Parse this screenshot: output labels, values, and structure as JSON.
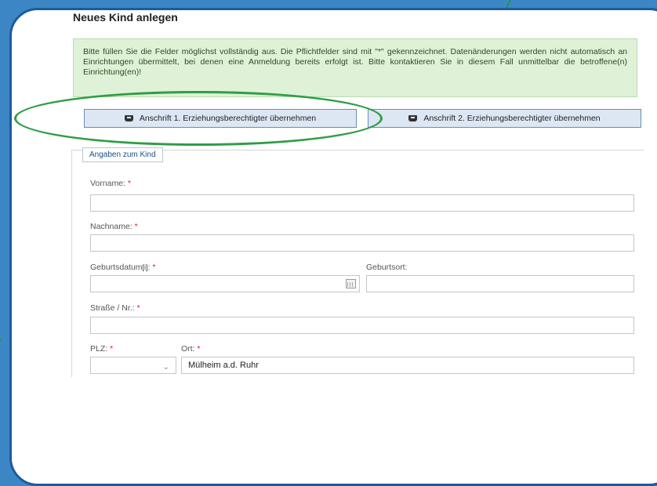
{
  "page": {
    "title": "Neues Kind anlegen",
    "notice": "Bitte füllen Sie die Felder möglichst vollständig aus. Die Pflichtfelder sind mit \"*\" gekennzeichnet. Datenänderungen werden nicht automatisch an Einrichtungen übermittelt, bei denen eine Anmeldung bereits erfolgt ist. Bitte kontaktieren Sie in diesem Fall unmittelbar die betroffene(n) Einrichtung(en)!"
  },
  "buttons": {
    "copy_guardian_1": "Anschrift 1. Erziehungsberechtigter übernehmen",
    "copy_guardian_2": "Anschrift 2. Erziehungsberechtigter übernehmen"
  },
  "section": {
    "legend": "Angaben zum Kind"
  },
  "fields": {
    "vorname": {
      "label": "Vorname:",
      "value": ""
    },
    "nachname": {
      "label": "Nachname:",
      "value": ""
    },
    "geburtsdatum": {
      "label": "Geburtsdatum",
      "info_marker": "[i]",
      "value": ""
    },
    "geburtsort": {
      "label": "Geburtsort:",
      "value": ""
    },
    "strasse": {
      "label": "Straße / Nr.:",
      "value": ""
    },
    "plz": {
      "label": "PLZ:",
      "value": ""
    },
    "ort": {
      "label": "Ort:",
      "value": "Mülheim a.d. Ruhr"
    }
  },
  "required_marker": "*",
  "colors": {
    "background": "#3d86c6",
    "frame_border": "#1b5c9b",
    "highlight": "#2f9e45",
    "notice_bg": "#dff2d8",
    "button_bg": "#dde7f3"
  }
}
